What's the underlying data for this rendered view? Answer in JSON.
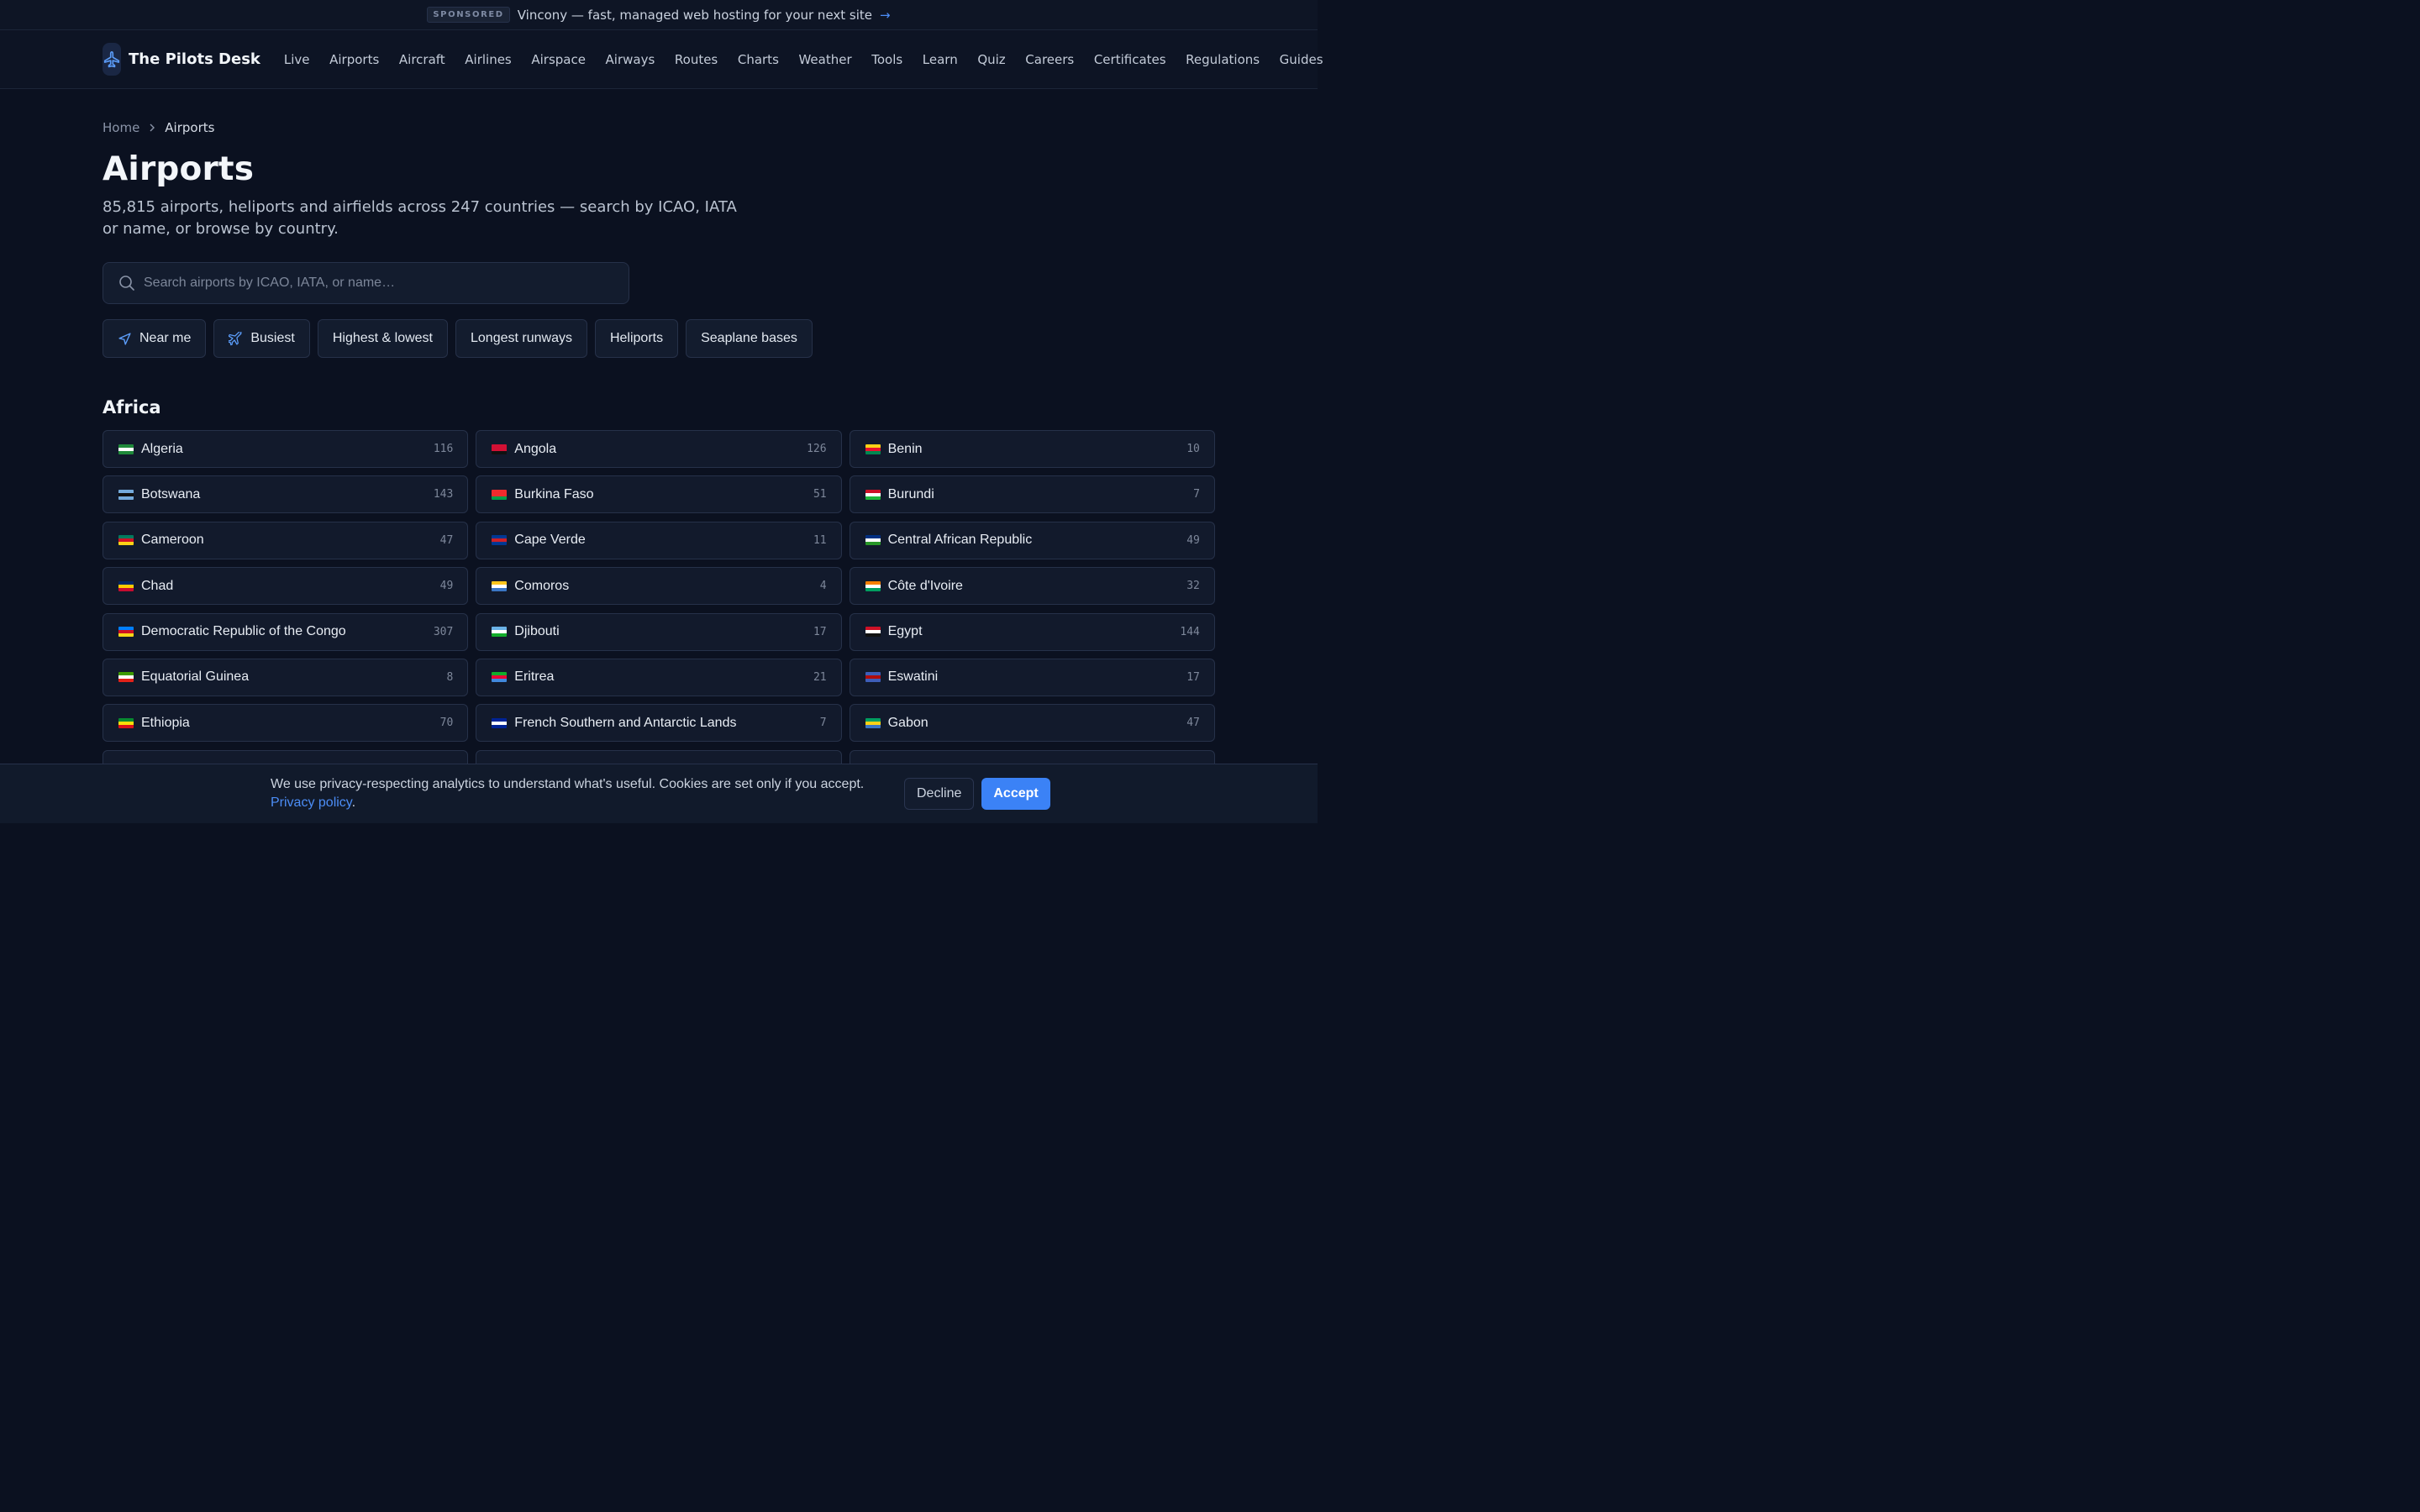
{
  "sponsor": {
    "badge": "SPONSORED",
    "text": "Vincony — fast, managed web hosting for your next site",
    "arrow": "→"
  },
  "header": {
    "brand": "The Pilots Desk",
    "logo_icon": "airplane-icon",
    "nav": [
      "Live",
      "Airports",
      "Aircraft",
      "Airlines",
      "Airspace",
      "Airways",
      "Routes",
      "Charts",
      "Weather",
      "Tools",
      "Learn",
      "Quiz",
      "Careers",
      "Certificates",
      "Regulations",
      "Guides"
    ]
  },
  "breadcrumb": {
    "home": "Home",
    "current": "Airports"
  },
  "page": {
    "title": "Airports",
    "subtitle": "85,815 airports, heliports and airfields across 247 countries — search by ICAO, IATA or name, or browse by country."
  },
  "search": {
    "placeholder": "Search airports by ICAO, IATA, or name…",
    "icon": "search-icon"
  },
  "filters": [
    {
      "label": "Near me",
      "icon": "navigation-icon"
    },
    {
      "label": "Busiest",
      "icon": "plane-icon"
    },
    {
      "label": "Highest & lowest"
    },
    {
      "label": "Longest runways"
    },
    {
      "label": "Heliports"
    },
    {
      "label": "Seaplane bases"
    }
  ],
  "region": {
    "name": "Africa",
    "countries": [
      {
        "name": "Algeria",
        "count": "116",
        "flag": [
          "#1f8a3a",
          "#ffffff",
          "#1f8a3a"
        ]
      },
      {
        "name": "Angola",
        "count": "126",
        "flag": [
          "#d21034",
          "#d21034",
          "#111111"
        ]
      },
      {
        "name": "Benin",
        "count": "10",
        "flag": [
          "#fcd116",
          "#e8112d",
          "#008751"
        ]
      },
      {
        "name": "Botswana",
        "count": "143",
        "flag": [
          "#75aadb",
          "#111111",
          "#75aadb"
        ]
      },
      {
        "name": "Burkina Faso",
        "count": "51",
        "flag": [
          "#ef2b2d",
          "#ef2b2d",
          "#009e49"
        ]
      },
      {
        "name": "Burundi",
        "count": "7",
        "flag": [
          "#ce1126",
          "#ffffff",
          "#1eb53a"
        ]
      },
      {
        "name": "Cameroon",
        "count": "47",
        "flag": [
          "#007a5e",
          "#ce1126",
          "#fcd116"
        ]
      },
      {
        "name": "Cape Verde",
        "count": "11",
        "flag": [
          "#003893",
          "#cf2027",
          "#003893"
        ]
      },
      {
        "name": "Central African Republic",
        "count": "49",
        "flag": [
          "#003082",
          "#ffffff",
          "#289728"
        ]
      },
      {
        "name": "Chad",
        "count": "49",
        "flag": [
          "#002664",
          "#fecb00",
          "#c60c30"
        ]
      },
      {
        "name": "Comoros",
        "count": "4",
        "flag": [
          "#ffc61e",
          "#ffffff",
          "#3a75c4"
        ]
      },
      {
        "name": "Côte d'Ivoire",
        "count": "32",
        "flag": [
          "#f77f00",
          "#ffffff",
          "#009e60"
        ]
      },
      {
        "name": "Democratic Republic of the Congo",
        "count": "307",
        "flag": [
          "#007fff",
          "#ce1021",
          "#f7d618"
        ]
      },
      {
        "name": "Djibouti",
        "count": "17",
        "flag": [
          "#6ab2e7",
          "#ffffff",
          "#12ad2b"
        ]
      },
      {
        "name": "Egypt",
        "count": "144",
        "flag": [
          "#ce1126",
          "#ffffff",
          "#111111"
        ]
      },
      {
        "name": "Equatorial Guinea",
        "count": "8",
        "flag": [
          "#3e9a00",
          "#ffffff",
          "#e32118"
        ]
      },
      {
        "name": "Eritrea",
        "count": "21",
        "flag": [
          "#12ad2b",
          "#ea0437",
          "#4189dd"
        ]
      },
      {
        "name": "Eswatini",
        "count": "17",
        "flag": [
          "#3e5eb9",
          "#b10c0c",
          "#3e5eb9"
        ]
      },
      {
        "name": "Ethiopia",
        "count": "70",
        "flag": [
          "#078930",
          "#fcdd09",
          "#da121a"
        ]
      },
      {
        "name": "French Southern and Antarctic Lands",
        "count": "7",
        "flag": [
          "#002395",
          "#ffffff",
          "#002395"
        ]
      },
      {
        "name": "Gabon",
        "count": "47",
        "flag": [
          "#009e60",
          "#fcd116",
          "#3a75c4"
        ]
      },
      {
        "name": "",
        "count": "",
        "flag": [
          "#1a2335",
          "#1a2335",
          "#1a2335"
        ]
      },
      {
        "name": "",
        "count": "",
        "flag": [
          "#1a2335",
          "#1a2335",
          "#1a2335"
        ]
      },
      {
        "name": "",
        "count": "",
        "flag": [
          "#1a2335",
          "#1a2335",
          "#1a2335"
        ]
      }
    ]
  },
  "cookie": {
    "text": "We use privacy-respecting analytics to understand what's useful. Cookies are set only if you accept.",
    "link": "Privacy policy",
    "after_link": ".",
    "decline": "Decline",
    "accept": "Accept"
  },
  "colors": {
    "accent": "#3b82f6",
    "background": "#0b1120",
    "card": "#121a2c"
  }
}
